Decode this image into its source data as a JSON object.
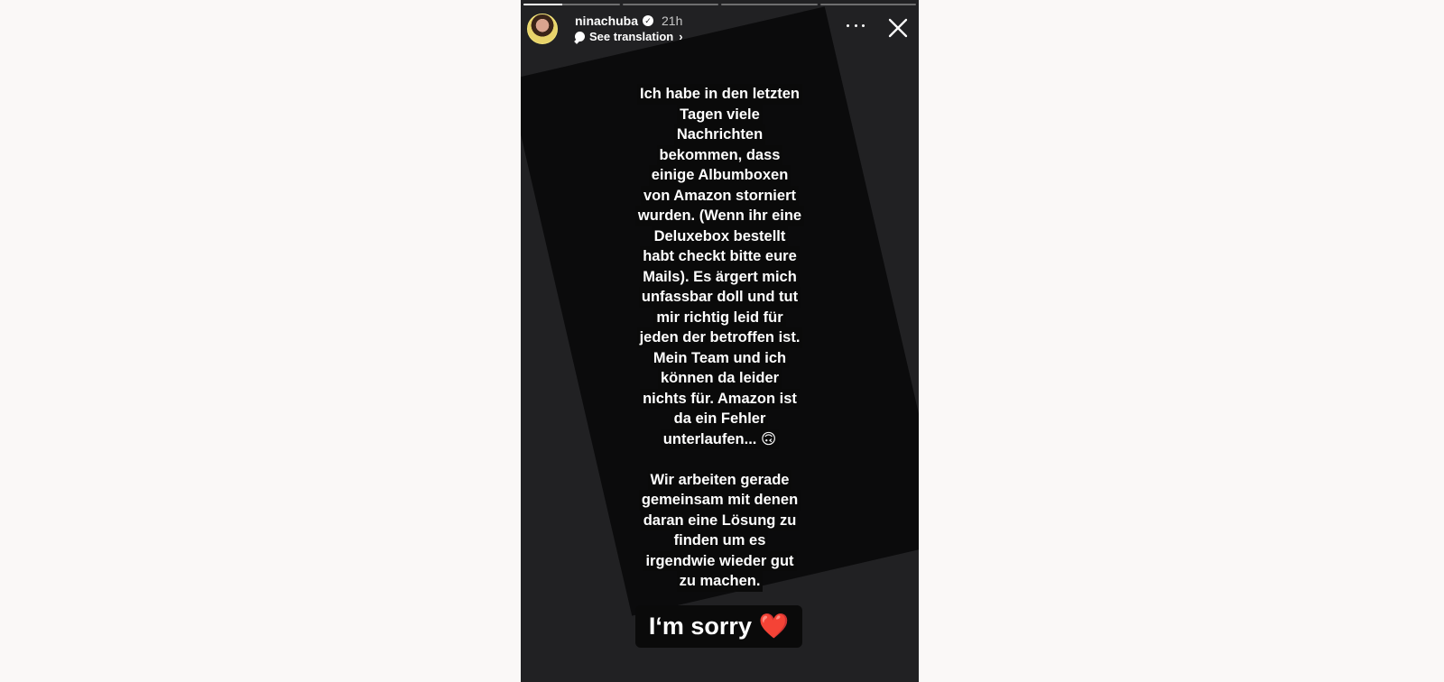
{
  "story": {
    "progress_fill": [
      0.4,
      0,
      0,
      0
    ],
    "user": {
      "username": "ninachuba",
      "verified": true,
      "time": "21h",
      "translation": "See translation"
    },
    "icons": {
      "avatar": "avatar",
      "verified": "verified-badge-icon",
      "translation": "speech-bubble-icon",
      "chevron": "chevron-right-icon",
      "more": "more-icon",
      "close": "close-icon"
    },
    "text_lines": [
      "Ich habe in den letzten",
      "Tagen viele",
      "Nachrichten",
      "bekommen, dass",
      "einige Albumboxen",
      "von Amazon storniert",
      "wurden. (Wenn ihr eine",
      "Deluxebox bestellt",
      "habt checkt bitte eure",
      "Mails). Es ärgert mich",
      "unfassbar doll und tut",
      "mir richtig leid für",
      "jeden der betroffen ist.",
      "Mein Team und ich",
      "können da leider",
      "nichts für. Amazon ist",
      "da ein Fehler",
      "unterlaufen... 🙃",
      "",
      "Wir arbeiten gerade",
      "gemeinsam mit denen",
      "daran eine Lösung zu",
      "finden um es",
      "irgendwie wieder gut",
      "zu machen."
    ],
    "sticker": "I‘m sorry ❤️"
  }
}
